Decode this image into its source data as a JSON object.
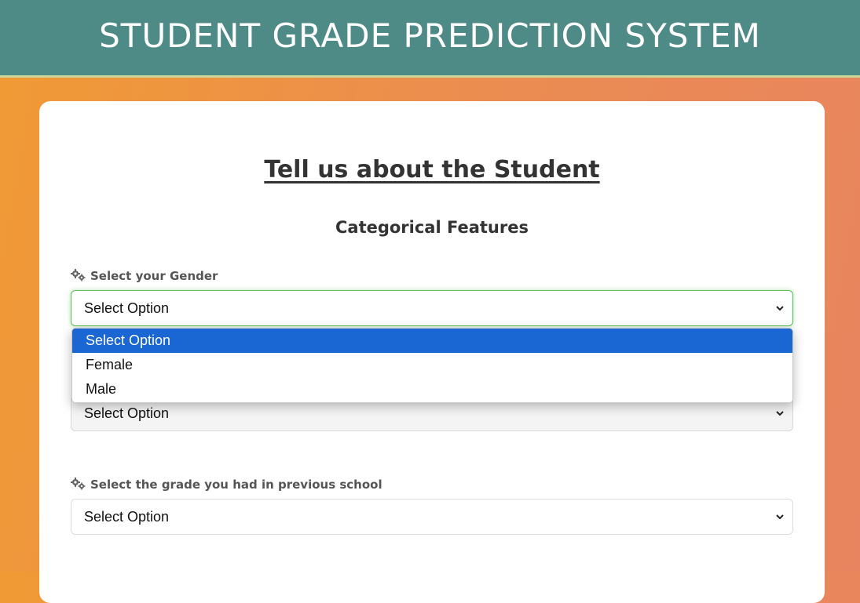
{
  "header": {
    "title": "STUDENT GRADE PREDICTION SYSTEM"
  },
  "card": {
    "title": "Tell us about the Student",
    "section_title": "Categorical Features"
  },
  "fields": [
    {
      "label": "Select your Gender",
      "value": "Select Option"
    },
    {
      "label": "",
      "value": "Select Option"
    },
    {
      "label": "Select the grade you had in previous school",
      "value": "Select Option"
    }
  ],
  "dropdown": {
    "options": [
      "Select Option",
      "Female",
      "Male"
    ],
    "selected": "Select Option"
  },
  "colors": {
    "header_bg": "#4e8b87",
    "accent_selected": "#1a66d2",
    "focus_border": "#5bbf5b"
  },
  "icons": {
    "label_icon": "gears-icon",
    "select_icon": "chevron-down-icon"
  }
}
